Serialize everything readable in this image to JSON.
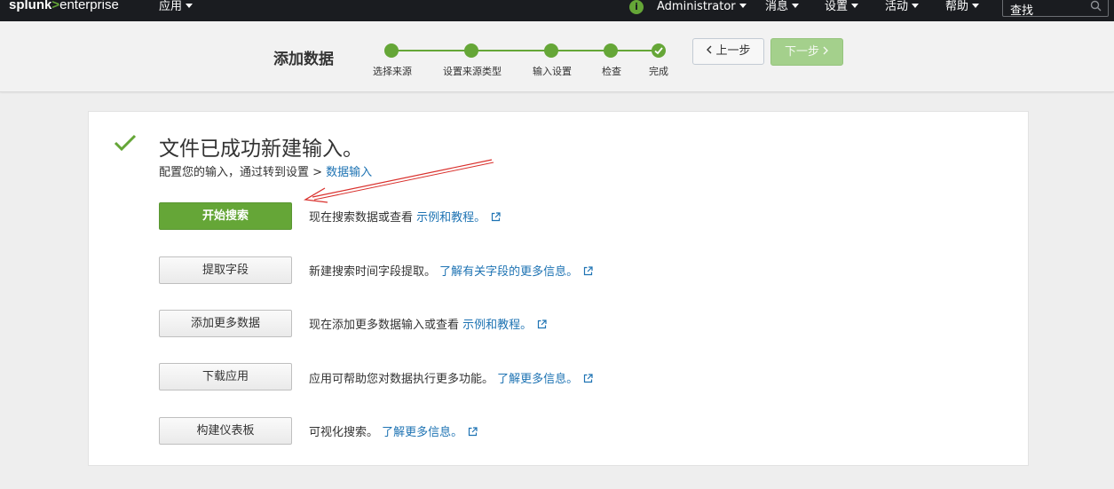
{
  "topnav": {
    "logo": {
      "part1": "splunk",
      "gt": ">",
      "part2": "enterprise"
    },
    "apps_label": "应用",
    "info_icon_glyph": "i",
    "user_label": "Administrator",
    "messages_label": "消息",
    "settings_label": "设置",
    "activity_label": "活动",
    "help_label": "帮助",
    "search_label": "查找"
  },
  "header": {
    "title": "添加数据",
    "steps": [
      {
        "label": "选择来源"
      },
      {
        "label": "设置来源类型"
      },
      {
        "label": "输入设置"
      },
      {
        "label": "检查"
      },
      {
        "label": "完成"
      }
    ],
    "prev_label": "上一步",
    "next_label": "下一步"
  },
  "main": {
    "success_title": "文件已成功新建输入。",
    "config_text": "配置您的输入，通过转到设置 >",
    "config_link": "数据输入",
    "actions": [
      {
        "button": "开始搜索",
        "text": "现在搜索数据或查看",
        "link": "示例和教程。"
      },
      {
        "button": "提取字段",
        "text": "新建搜索时间字段提取。",
        "link": "了解有关字段的更多信息。"
      },
      {
        "button": "添加更多数据",
        "text": "现在添加更多数据输入或查看",
        "link": "示例和教程。"
      },
      {
        "button": "下载应用",
        "text": "应用可帮助您对数据执行更多功能。",
        "link": "了解更多信息。"
      },
      {
        "button": "构建仪表板",
        "text": "可视化搜索。",
        "link": "了解更多信息。"
      }
    ]
  },
  "colors": {
    "accent_green": "#65a637",
    "link_blue": "#1e73b3",
    "nav_bg": "#1a1c20",
    "annotation_red": "#d9302c"
  }
}
